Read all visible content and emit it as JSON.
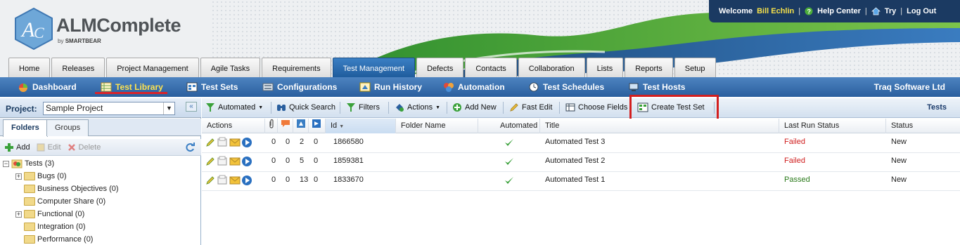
{
  "header": {
    "brand": "ALMComplete",
    "brand_sub_prefix": "by",
    "brand_sub_name": "SMARTBEAR",
    "welcome": "Welcome",
    "user_name": "Bill Echlin",
    "help_center": "Help Center",
    "try": "Try",
    "logout": "Log Out",
    "sep": "|"
  },
  "main_tabs": [
    "Home",
    "Releases",
    "Project Management",
    "Agile Tasks",
    "Requirements",
    "Test Management",
    "Defects",
    "Contacts",
    "Collaboration",
    "Lists",
    "Reports",
    "Setup"
  ],
  "active_main_tab": "Test Management",
  "sub_nav": {
    "items": [
      "Dashboard",
      "Test Library",
      "Test Sets",
      "Configurations",
      "Run History",
      "Automation",
      "Test Schedules",
      "Test Hosts"
    ],
    "selected": "Test Library",
    "company": "Traq Software Ltd"
  },
  "left_panel": {
    "project_label": "Project:",
    "project_value": "Sample Project",
    "collapse": "«",
    "tabs": [
      "Folders",
      "Groups"
    ],
    "toolbar": {
      "add": "Add",
      "edit": "Edit",
      "delete": "Delete"
    },
    "tree": {
      "root": "Tests (3)",
      "children": [
        "Bugs (0)",
        "Business Objectives (0)",
        "Computer Share (0)",
        "Functional (0)",
        "Integration (0)",
        "Performance (0)"
      ]
    }
  },
  "toolbar": {
    "automated": "Automated",
    "quick_search": "Quick Search",
    "filters": "Filters",
    "actions": "Actions",
    "add_new": "Add New",
    "fast_edit": "Fast Edit",
    "choose_fields": "Choose Fields",
    "create_test_set": "Create Test Set",
    "section": "Tests"
  },
  "grid": {
    "columns": [
      "Actions",
      "Id",
      "Folder Name",
      "Automated",
      "Title",
      "Last Run Status",
      "Status"
    ],
    "rows": [
      {
        "c1": "0",
        "c2": "0",
        "c3": "2",
        "c4": "0",
        "id": "1866580",
        "folder": "",
        "automated": true,
        "title": "Automated Test 3",
        "last_run": "Failed",
        "status": "New"
      },
      {
        "c1": "0",
        "c2": "0",
        "c3": "5",
        "c4": "0",
        "id": "1859381",
        "folder": "",
        "automated": true,
        "title": "Automated Test 2",
        "last_run": "Failed",
        "status": "New"
      },
      {
        "c1": "0",
        "c2": "0",
        "c3": "13",
        "c4": "0",
        "id": "1833670",
        "folder": "",
        "automated": true,
        "title": "Automated Test 1",
        "last_run": "Passed",
        "status": "New"
      }
    ]
  },
  "colors": {
    "accent": "#2a5f9e",
    "header_dark": "#1b3a62",
    "failed": "#d02020",
    "passed": "#2a7a1a",
    "highlight": "#d31f1f",
    "selected_nav": "#ffe34f"
  }
}
